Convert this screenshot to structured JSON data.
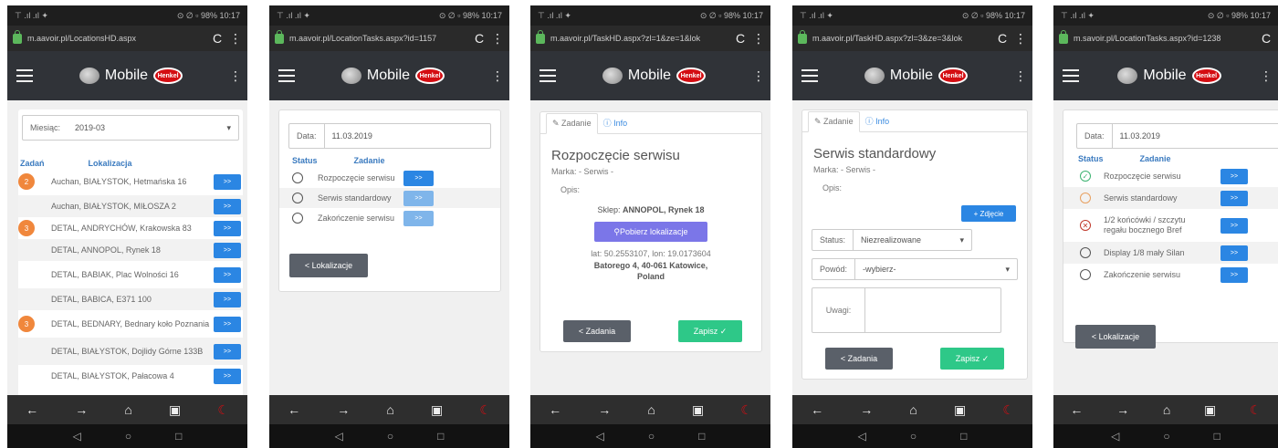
{
  "common": {
    "app_name": "Mobile",
    "brand_logo": "Henkel",
    "status_left": "⊤ .ıl .ıl ✦",
    "status_right": "⊙ ∅ ▫ 98% 10:17",
    "next_label": ">>",
    "icons": {
      "back": "←",
      "forward": "→",
      "home": "⌂",
      "tabs": "▣",
      "moon": "☾",
      "sys_back": "◁",
      "sys_home": "○",
      "sys_recent": "□",
      "reload": "C",
      "menu": "⋮"
    }
  },
  "screen1": {
    "url": "m.aavoir.pl/LocationsHD.aspx",
    "month_label": "Miesiąc:",
    "month_value": "2019-03",
    "col_tasks": "Zadań",
    "col_location": "Lokalizacja",
    "rows": [
      {
        "badge": "2",
        "text": "Auchan, BIAŁYSTOK, Hetmańska 16"
      },
      {
        "badge": "",
        "text": "Auchan, BIAŁYSTOK, MIŁOSZA 2"
      },
      {
        "badge": "3",
        "text": "DETAL, ANDRYCHÓW, Krakowska 83"
      },
      {
        "badge": "",
        "text": "DETAL, ANNOPOL, Rynek 18"
      },
      {
        "badge": "",
        "text": "DETAL, BABIAK, Plac Wolności 16"
      },
      {
        "badge": "",
        "text": "DETAL, BABICA, E371 100"
      },
      {
        "badge": "3",
        "text": "DETAL, BEDNARY, Bednary koło Poznania"
      },
      {
        "badge": "",
        "text": "DETAL, BIAŁYSTOK, Dojlidy Górne 133B"
      },
      {
        "badge": "",
        "text": "DETAL, BIAŁYSTOK, Pałacowa 4"
      }
    ]
  },
  "screen2": {
    "url": "m.aavoir.pl/LocationTasks.aspx?id=1157",
    "date_label": "Data:",
    "date_value": "11.03.2019",
    "col_status": "Status",
    "col_task": "Zadanie",
    "tasks": [
      "Rozpoczęcie serwisu",
      "Serwis standardowy",
      "Zakończenie serwisu"
    ],
    "back_button": "< Lokalizacje"
  },
  "screen3": {
    "url": "m.aavoir.pl/TaskHD.aspx?zl=1&ze=1&lok",
    "tab_task": "Zadanie",
    "tab_info": "Info",
    "title": "Rozpoczęcie serwisu",
    "marka": "Marka: - Serwis -",
    "opis": "Opis:",
    "shop_prefix": "Sklep:",
    "shop_name": "ANNOPOL, Rynek 18",
    "location_button": "Pobierz lokalizacje",
    "coords": "lat: 50.2553107, lon: 19.0173604",
    "address": "Batorego 4, 40-061 Katowice, Poland",
    "back_button": "< Zadania",
    "save_button": "Zapisz ✓"
  },
  "screen4": {
    "url": "m.aavoir.pl/TaskHD.aspx?zl=3&ze=3&lok",
    "tab_task": "Zadanie",
    "tab_info": "Info",
    "title": "Serwis standardowy",
    "marka": "Marka: - Serwis -",
    "opis": "Opis:",
    "photo_button": "+ Zdjęcie",
    "status_label": "Status:",
    "status_value": "Niezrealizowane",
    "reason_label": "Powód:",
    "reason_value": "-wybierz-",
    "notes_label": "Uwagi:",
    "back_button": "< Zadania",
    "save_button": "Zapisz ✓"
  },
  "screen5": {
    "url": "m.savoir.pl/LocationTasks.aspx?id=1238",
    "date_label": "Data:",
    "date_value": "11.03.2019",
    "col_status": "Status",
    "col_task": "Zadanie",
    "tasks": [
      {
        "state": "done",
        "text": "Rozpoczęcie serwisu"
      },
      {
        "state": "progress",
        "text": "Serwis standardowy"
      },
      {
        "state": "failed",
        "text": "1/2 końcówki / szczytu regału bocznego Bref"
      },
      {
        "state": "open",
        "text": "Display 1/8 mały Silan"
      },
      {
        "state": "open",
        "text": "Zakończenie serwisu"
      }
    ],
    "back_button": "< Lokalizacje",
    "colors": {
      "done": "#3cb371",
      "progress": "#e8a060",
      "failed": "#c0392b",
      "open": "#555555"
    }
  }
}
